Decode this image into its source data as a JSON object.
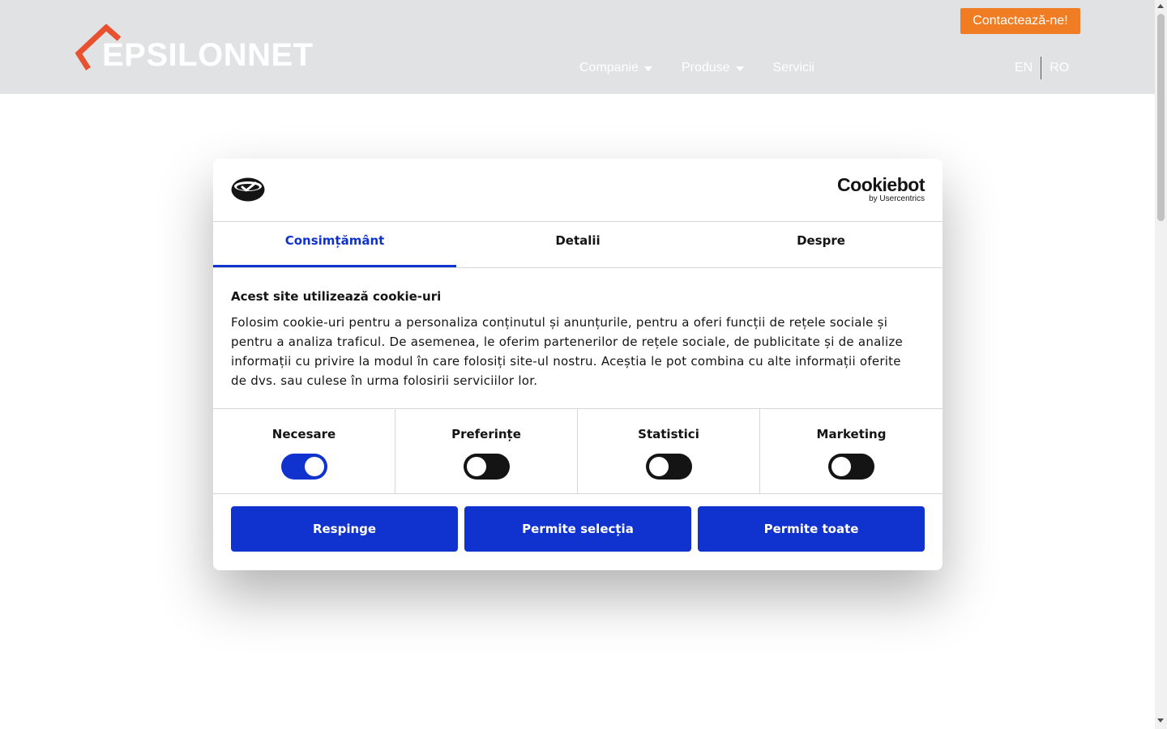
{
  "header": {
    "logo_text": "EPSILONNET",
    "contact_label": "Contactează-ne!",
    "nav": [
      {
        "label": "Companie",
        "has_dropdown": true
      },
      {
        "label": "Produse",
        "has_dropdown": true
      },
      {
        "label": "Servicii",
        "has_dropdown": false
      }
    ],
    "languages": [
      "EN",
      "RO"
    ]
  },
  "cookie_dialog": {
    "brand_name": "Cookiebot",
    "brand_sub": "by Usercentrics",
    "tabs": [
      {
        "label": "Consimțământ",
        "active": true
      },
      {
        "label": "Detalii",
        "active": false
      },
      {
        "label": "Despre",
        "active": false
      }
    ],
    "title": "Acest site utilizează cookie-uri",
    "body": "Folosim cookie-uri pentru a personaliza conținutul și anunțurile, pentru a oferi funcții de rețele sociale și pentru a analiza traficul. De asemenea, le oferim partenerilor de rețele sociale, de publicitate și de analize informații cu privire la modul în care folosiți site-ul nostru. Aceștia le pot combina cu alte informații oferite de dvs. sau culese în urma folosirii serviciilor lor.",
    "toggles": [
      {
        "label": "Necesare",
        "on": true
      },
      {
        "label": "Preferințe",
        "on": false
      },
      {
        "label": "Statistici",
        "on": false
      },
      {
        "label": "Marketing",
        "on": false
      }
    ],
    "buttons": {
      "reject": "Respinge",
      "allow_selection": "Permite selecția",
      "allow_all": "Permite toate"
    }
  },
  "colors": {
    "header_bg": "#e1e2e4",
    "logo_accent": "#e8512f",
    "contact_bg": "#f07d23",
    "cookiebot_blue": "#1032cf",
    "toggle_off": "#141414"
  },
  "icons": {
    "logo_mark": "chevron-roof-icon",
    "consent_logo": "cookie-consent-icon",
    "dropdown": "caret-down-icon"
  }
}
